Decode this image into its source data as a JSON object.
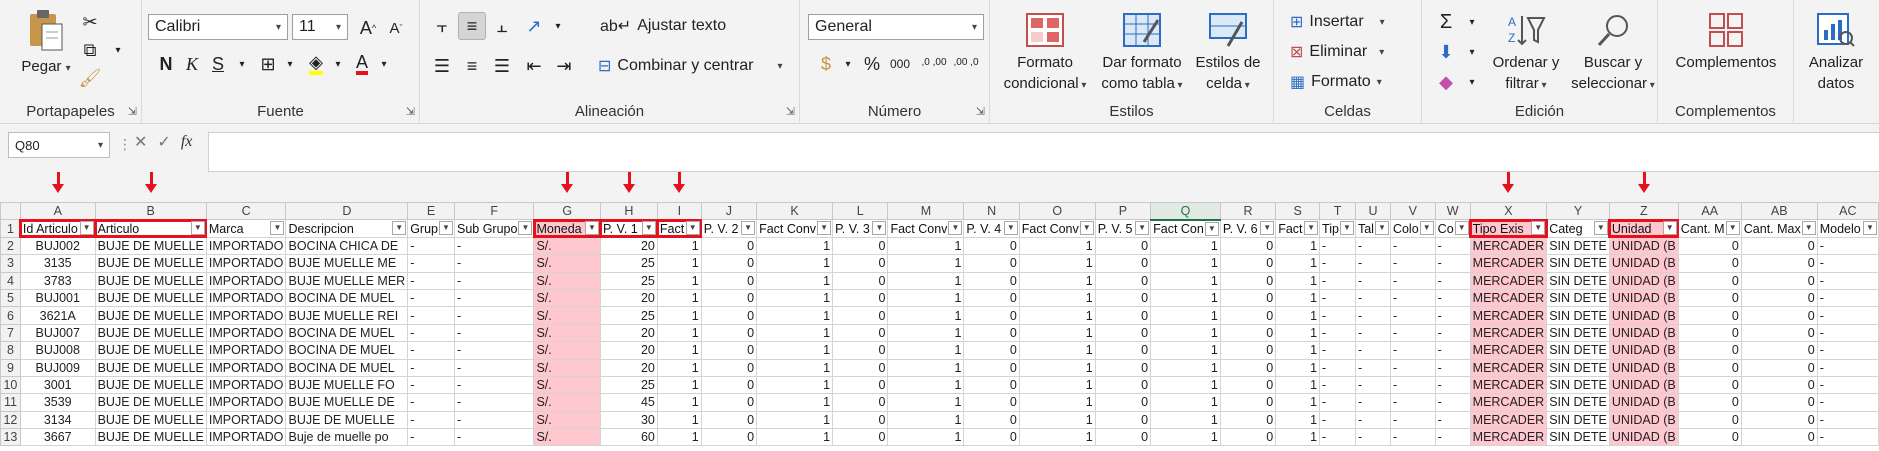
{
  "ribbon": {
    "portapapeles": {
      "label": "Portapapeles",
      "pegar": "Pegar"
    },
    "fuente": {
      "label": "Fuente",
      "font_name": "Calibri",
      "font_size": "11",
      "bold": "N",
      "italic": "K",
      "underline": "S",
      "grow": "A",
      "shrink": "A",
      "font_color": "A"
    },
    "alineacion": {
      "label": "Alineación",
      "ajustar": "Ajustar texto",
      "combinar": "Combinar y centrar"
    },
    "numero": {
      "label": "Número",
      "format": "General",
      "percent": "%",
      "thousands": "000",
      "inc_dec": ",0 ,00",
      "dec_dec": ",00 ,0"
    },
    "estilos": {
      "label": "Estilos",
      "cond_l1": "Formato",
      "cond_l2": "condicional",
      "tabla_l1": "Dar formato",
      "tabla_l2": "como tabla",
      "celda_l1": "Estilos de",
      "celda_l2": "celda"
    },
    "celdas": {
      "label": "Celdas",
      "insertar": "Insertar",
      "eliminar": "Eliminar",
      "formato": "Formato"
    },
    "edicion": {
      "label": "Edición",
      "sigma": "Σ",
      "ordenar_l1": "Ordenar y",
      "ordenar_l2": "filtrar",
      "buscar_l1": "Buscar y",
      "buscar_l2": "seleccionar"
    },
    "complementos": {
      "label": "Complementos",
      "btn": "Complementos"
    },
    "analizar": {
      "l1": "Analizar",
      "l2": "datos"
    }
  },
  "formula_bar": {
    "name_box": "Q80",
    "fx": "fx",
    "cancel": "✕",
    "enter": "✓",
    "content": ""
  },
  "sheet": {
    "columns": [
      "A",
      "B",
      "C",
      "D",
      "E",
      "F",
      "G",
      "H",
      "I",
      "J",
      "K",
      "L",
      "M",
      "N",
      "O",
      "P",
      "Q",
      "R",
      "S",
      "T",
      "U",
      "V",
      "W",
      "X",
      "Y",
      "Z",
      "AA",
      "AB",
      "AC"
    ],
    "row_numbers": [
      "1",
      "2",
      "3",
      "4",
      "5",
      "6",
      "7",
      "8",
      "9",
      "10",
      "11",
      "12",
      "13"
    ],
    "headers": [
      "Id Articulo",
      "Articulo",
      "Marca",
      "Descripcion",
      "Grup",
      "Sub Grupo",
      "Moneda",
      "P. V. 1",
      "Fact",
      "P. V. 2",
      "Fact Conv",
      "P. V. 3",
      "Fact Conv",
      "P. V. 4",
      "Fact Conv",
      "P. V. 5",
      "Fact Con",
      "P. V. 6",
      "Fact",
      "Tip",
      "Tal",
      "Colo",
      "Co",
      "Tipo Exis",
      "Categ",
      "Unidad",
      "Cant. M",
      "Cant. Max",
      "Modelo"
    ],
    "rows": [
      [
        "BUJ002",
        "BUJE DE MUELLE",
        "IMPORTADO",
        "BOCINA CHICA DE",
        "-",
        "-",
        "S/.",
        "20",
        "1",
        "0",
        "1",
        "0",
        "1",
        "0",
        "1",
        "0",
        "1",
        "0",
        "1",
        "-",
        "-",
        "-",
        "-",
        "MERCADER",
        "SIN DETE",
        "UNIDAD (B",
        "0",
        "0",
        "-"
      ],
      [
        "3135",
        "BUJE DE MUELLE",
        "IMPORTADO",
        "BUJE MUELLE ME",
        "-",
        "-",
        "S/.",
        "25",
        "1",
        "0",
        "1",
        "0",
        "1",
        "0",
        "1",
        "0",
        "1",
        "0",
        "1",
        "-",
        "-",
        "-",
        "-",
        "MERCADER",
        "SIN DETE",
        "UNIDAD (B",
        "0",
        "0",
        "-"
      ],
      [
        "3783",
        "BUJE DE MUELLE",
        "IMPORTADO",
        "BUJE MUELLE MER",
        "-",
        "-",
        "S/.",
        "25",
        "1",
        "0",
        "1",
        "0",
        "1",
        "0",
        "1",
        "0",
        "1",
        "0",
        "1",
        "-",
        "-",
        "-",
        "-",
        "MERCADER",
        "SIN DETE",
        "UNIDAD (B",
        "0",
        "0",
        "-"
      ],
      [
        "BUJ001",
        "BUJE DE MUELLE",
        "IMPORTADO",
        "BOCINA DE MUEL",
        "-",
        "-",
        "S/.",
        "20",
        "1",
        "0",
        "1",
        "0",
        "1",
        "0",
        "1",
        "0",
        "1",
        "0",
        "1",
        "-",
        "-",
        "-",
        "-",
        "MERCADER",
        "SIN DETE",
        "UNIDAD (B",
        "0",
        "0",
        "-"
      ],
      [
        "3621A",
        "BUJE DE MUELLE",
        "IMPORTADO",
        "BUJE MUELLE REI",
        "-",
        "-",
        "S/.",
        "25",
        "1",
        "0",
        "1",
        "0",
        "1",
        "0",
        "1",
        "0",
        "1",
        "0",
        "1",
        "-",
        "-",
        "-",
        "-",
        "MERCADER",
        "SIN DETE",
        "UNIDAD (B",
        "0",
        "0",
        "-"
      ],
      [
        "BUJ007",
        "BUJE DE MUELLE",
        "IMPORTADO",
        "BOCINA DE MUEL",
        "-",
        "-",
        "S/.",
        "20",
        "1",
        "0",
        "1",
        "0",
        "1",
        "0",
        "1",
        "0",
        "1",
        "0",
        "1",
        "-",
        "-",
        "-",
        "-",
        "MERCADER",
        "SIN DETE",
        "UNIDAD (B",
        "0",
        "0",
        "-"
      ],
      [
        "BUJ008",
        "BUJE DE MUELLE",
        "IMPORTADO",
        "BOCINA DE MUEL",
        "-",
        "-",
        "S/.",
        "20",
        "1",
        "0",
        "1",
        "0",
        "1",
        "0",
        "1",
        "0",
        "1",
        "0",
        "1",
        "-",
        "-",
        "-",
        "-",
        "MERCADER",
        "SIN DETE",
        "UNIDAD (B",
        "0",
        "0",
        "-"
      ],
      [
        "BUJ009",
        "BUJE DE MUELLE",
        "IMPORTADO",
        "BOCINA DE MUEL",
        "-",
        "-",
        "S/.",
        "20",
        "1",
        "0",
        "1",
        "0",
        "1",
        "0",
        "1",
        "0",
        "1",
        "0",
        "1",
        "-",
        "-",
        "-",
        "-",
        "MERCADER",
        "SIN DETE",
        "UNIDAD (B",
        "0",
        "0",
        "-"
      ],
      [
        "3001",
        "BUJE DE MUELLE",
        "IMPORTADO",
        "BUJE MUELLE FO",
        "-",
        "-",
        "S/.",
        "25",
        "1",
        "0",
        "1",
        "0",
        "1",
        "0",
        "1",
        "0",
        "1",
        "0",
        "1",
        "-",
        "-",
        "-",
        "-",
        "MERCADER",
        "SIN DETE",
        "UNIDAD (B",
        "0",
        "0",
        "-"
      ],
      [
        "3539",
        "BUJE DE MUELLE",
        "IMPORTADO",
        "BUJE MUELLE DE",
        "-",
        "-",
        "S/.",
        "45",
        "1",
        "0",
        "1",
        "0",
        "1",
        "0",
        "1",
        "0",
        "1",
        "0",
        "1",
        "-",
        "-",
        "-",
        "-",
        "MERCADER",
        "SIN DETE",
        "UNIDAD (B",
        "0",
        "0",
        "-"
      ],
      [
        "3134",
        "BUJE DE MUELLE",
        "IMPORTADO",
        "BUJE DE MUELLE",
        "-",
        "-",
        "S/.",
        "30",
        "1",
        "0",
        "1",
        "0",
        "1",
        "0",
        "1",
        "0",
        "1",
        "0",
        "1",
        "-",
        "-",
        "-",
        "-",
        "MERCADER",
        "SIN DETE",
        "UNIDAD (B",
        "0",
        "0",
        "-"
      ],
      [
        "3667",
        "BUJE DE MUELLE",
        "IMPORTADO",
        "Buje de muelle po",
        "-",
        "-",
        "S/.",
        "60",
        "1",
        "0",
        "1",
        "0",
        "1",
        "0",
        "1",
        "0",
        "1",
        "0",
        "1",
        "-",
        "-",
        "-",
        "-",
        "MERCADER",
        "SIN DETE",
        "UNIDAD (B",
        "0",
        "0",
        "-"
      ]
    ]
  },
  "colors": {
    "accent": "#217346",
    "highlight_border": "#e8101c",
    "pink_fill": "#ffc7ce"
  }
}
